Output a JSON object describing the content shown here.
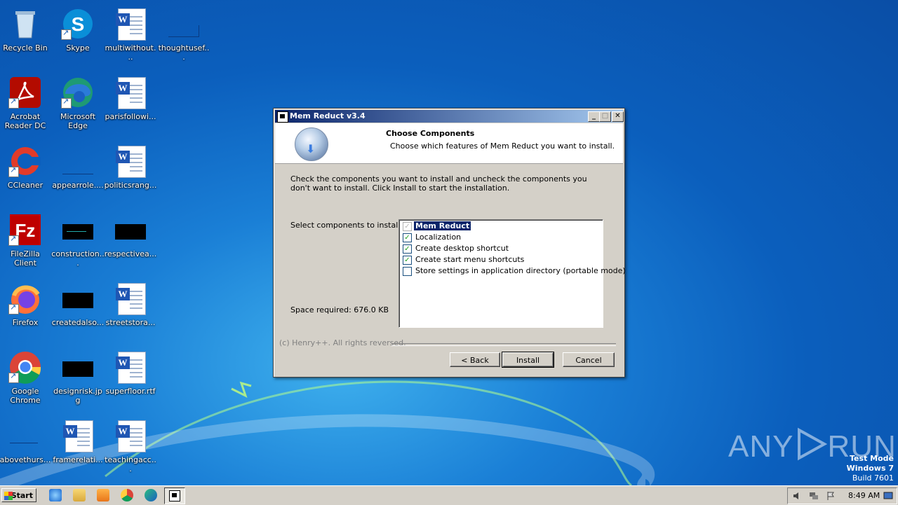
{
  "desktop": {
    "icons": [
      {
        "label": "Recycle Bin",
        "icon": "recycle-bin-icon"
      },
      {
        "label": "Skype",
        "icon": "skype-icon"
      },
      {
        "label": "multiwithout...",
        "icon": "word-document-icon"
      },
      {
        "label": "thoughtusef...",
        "icon": "blank-file-icon"
      },
      {
        "label": "Acrobat Reader DC",
        "icon": "acrobat-icon"
      },
      {
        "label": "Microsoft Edge",
        "icon": "edge-icon"
      },
      {
        "label": "parisfollowi...",
        "icon": "word-document-icon"
      },
      {
        "label": "CCleaner",
        "icon": "ccleaner-icon"
      },
      {
        "label": "appearrole....",
        "icon": "blank-file-icon"
      },
      {
        "label": "politicsrang...",
        "icon": "word-document-icon"
      },
      {
        "label": "FileZilla Client",
        "icon": "filezilla-icon"
      },
      {
        "label": "construction...",
        "icon": "image-file-icon"
      },
      {
        "label": "respectivea...",
        "icon": "image-file-icon"
      },
      {
        "label": "Firefox",
        "icon": "firefox-icon"
      },
      {
        "label": "createdalso...",
        "icon": "image-file-icon"
      },
      {
        "label": "streetstora...",
        "icon": "word-document-icon"
      },
      {
        "label": "Google Chrome",
        "icon": "chrome-icon"
      },
      {
        "label": "designrisk.jpg",
        "icon": "image-file-icon"
      },
      {
        "label": "superfloor.rtf",
        "icon": "word-document-icon"
      },
      {
        "label": "abovethurs...",
        "icon": "blank-file-icon"
      },
      {
        "label": "framerelati...",
        "icon": "word-document-icon"
      },
      {
        "label": "teachingacc...",
        "icon": "word-document-icon"
      }
    ]
  },
  "window": {
    "title": "Mem Reduct v3.4",
    "header_title": "Choose Components",
    "header_subtitle": "Choose which features of Mem Reduct you want to install.",
    "instructions": "Check the components you want to install and uncheck the components you don't want to install. Click Install to start the installation.",
    "select_label": "Select components to install:",
    "space_required": "Space required: 676.0 KB",
    "components": [
      {
        "label": "Mem Reduct",
        "checked": true,
        "disabled": true,
        "selected": true
      },
      {
        "label": "Localization",
        "checked": true,
        "disabled": false,
        "selected": false
      },
      {
        "label": "Create desktop shortcut",
        "checked": true,
        "disabled": false,
        "selected": false
      },
      {
        "label": "Create start menu shortcuts",
        "checked": true,
        "disabled": false,
        "selected": false
      },
      {
        "label": "Store settings in application directory (portable mode)",
        "checked": false,
        "disabled": false,
        "selected": false
      }
    ],
    "footer": "(c) Henry++. All rights reversed.",
    "buttons": {
      "back": "< Back",
      "install": "Install",
      "cancel": "Cancel"
    },
    "controls": {
      "minimize": "_",
      "maximize": "□",
      "close": "✕"
    }
  },
  "watermark": {
    "left": "ANY",
    "right": "RUN"
  },
  "os_info": {
    "line1": "Test Mode",
    "line2": "Windows 7",
    "line3": "Build 7601"
  },
  "taskbar": {
    "start_label": "Start",
    "clock": "8:49 AM",
    "pinned": [
      "internet-explorer-icon",
      "file-explorer-icon",
      "media-player-icon",
      "chrome-icon",
      "edge-icon",
      "mem-reduct-setup-icon"
    ]
  },
  "colors": {
    "title_start": "#0a246a",
    "title_end": "#a6caf0",
    "checkmark": "#21a121",
    "selection": "#0a246a"
  }
}
